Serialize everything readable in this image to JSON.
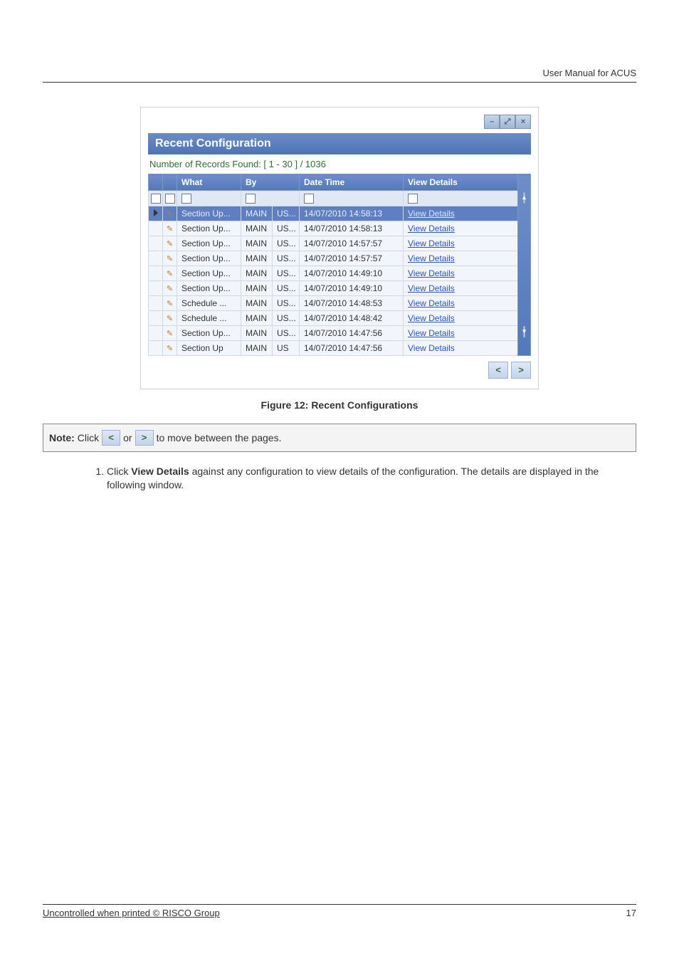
{
  "header": {
    "doc_title": "User Manual for ACUS"
  },
  "panel": {
    "title": "Recent Configuration",
    "records_found": "Number of Records Found: [ 1 - 30 ] / 1036",
    "headers": {
      "what": "What",
      "by": "By",
      "date": "Date Time",
      "view": "View Details"
    },
    "rows": [
      {
        "what": "Section Up...",
        "by1": "MAIN",
        "by2": "US...",
        "date": "14/07/2010 14:58:13",
        "view": "View Details"
      },
      {
        "what": "Section Up...",
        "by1": "MAIN",
        "by2": "US...",
        "date": "14/07/2010 14:58:13",
        "view": "View Details"
      },
      {
        "what": "Section Up...",
        "by1": "MAIN",
        "by2": "US...",
        "date": "14/07/2010 14:57:57",
        "view": "View Details"
      },
      {
        "what": "Section Up...",
        "by1": "MAIN",
        "by2": "US...",
        "date": "14/07/2010 14:57:57",
        "view": "View Details"
      },
      {
        "what": "Section Up...",
        "by1": "MAIN",
        "by2": "US...",
        "date": "14/07/2010 14:49:10",
        "view": "View Details"
      },
      {
        "what": "Section Up...",
        "by1": "MAIN",
        "by2": "US...",
        "date": "14/07/2010 14:49:10",
        "view": "View Details"
      },
      {
        "what": "Schedule ...",
        "by1": "MAIN",
        "by2": "US...",
        "date": "14/07/2010 14:48:53",
        "view": "View Details"
      },
      {
        "what": "Schedule ...",
        "by1": "MAIN",
        "by2": "US...",
        "date": "14/07/2010 14:48:42",
        "view": "View Details"
      },
      {
        "what": "Section Up...",
        "by1": "MAIN",
        "by2": "US...",
        "date": "14/07/2010 14:47:56",
        "view": "View Details"
      },
      {
        "what": "Section Up",
        "by1": "MAIN",
        "by2": "US",
        "date": "14/07/2010 14:47:56",
        "view": "View Details"
      }
    ]
  },
  "figure_caption": "Figure 12: Recent Configurations",
  "note": {
    "label": "Note:",
    "text1": " Click ",
    "text2": " or ",
    "text3": " to move between the pages."
  },
  "step": {
    "prefix": "Click ",
    "bold": "View Details",
    "suffix": " against any configuration to view details of the configuration. The details are displayed in the following window."
  },
  "footer": {
    "left": "Uncontrolled when printed © RISCO Group",
    "page": "17"
  }
}
